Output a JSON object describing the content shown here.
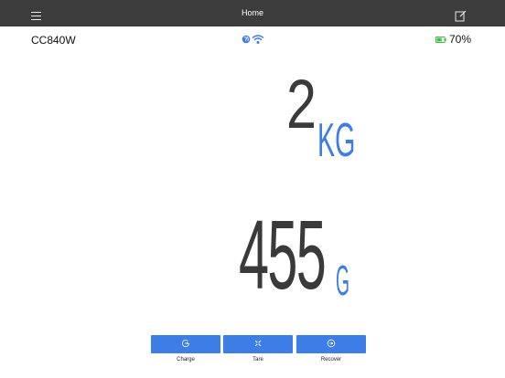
{
  "header": {
    "title": "Home"
  },
  "status": {
    "device_name": "CC840W",
    "battery_percent": "70%",
    "battery_level": 0.7,
    "battery_color": "#44c04a"
  },
  "readings": {
    "kilograms": "2",
    "kg_unit": "KG",
    "grams": "455",
    "g_unit": "G"
  },
  "actions": [
    {
      "label": "Charge"
    },
    {
      "label": "Tare"
    },
    {
      "label": "Recover"
    }
  ],
  "colors": {
    "accent": "#3d7de6",
    "topbar": "#3c3c3c",
    "digits": "#3a3a3a"
  }
}
